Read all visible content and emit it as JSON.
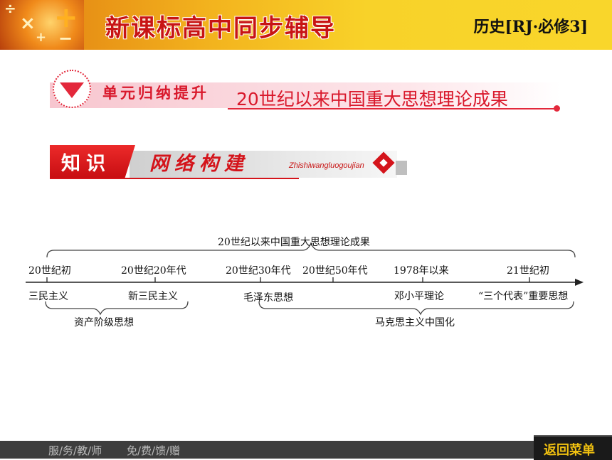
{
  "header": {
    "title": "新课标高中同步辅导",
    "subject": "历史[RJ·必修3]",
    "deco_symbols": [
      "×",
      "+",
      "÷",
      "−",
      "+"
    ]
  },
  "unit_banner": {
    "label": "单元归纳提升",
    "topic": "20世纪以来中国重大思想理论成果"
  },
  "knowledge_banner": {
    "tag": "知识",
    "title": "网络构建",
    "pinyin": "Zhishiwangluogoujian"
  },
  "timeline": {
    "overall_title": "20世纪以来中国重大思想理论成果",
    "periods": [
      {
        "time": "20世纪初",
        "idea": "三民主义"
      },
      {
        "time": "20世纪20年代",
        "idea": "新三民主义"
      },
      {
        "time": "20世纪30年代",
        "idea": "毛泽东思想"
      },
      {
        "time": "20世纪50年代",
        "idea": ""
      },
      {
        "time": "1978年以来",
        "idea": "邓小平理论"
      },
      {
        "time": "21世纪初",
        "idea": "“三个代表”重要思想"
      }
    ],
    "group_bourgeois": "资产阶级思想",
    "group_marxism": "马克思主义中国化"
  },
  "footer": {
    "left": "服/务/教/师",
    "right": "免/费/馈/赠",
    "back_button": "返回菜单"
  },
  "colors": {
    "brand_red": "#d4141b",
    "header_yellow": "#f8d229",
    "footer_grey": "#3d3d3d",
    "back_text": "#f0c010"
  }
}
